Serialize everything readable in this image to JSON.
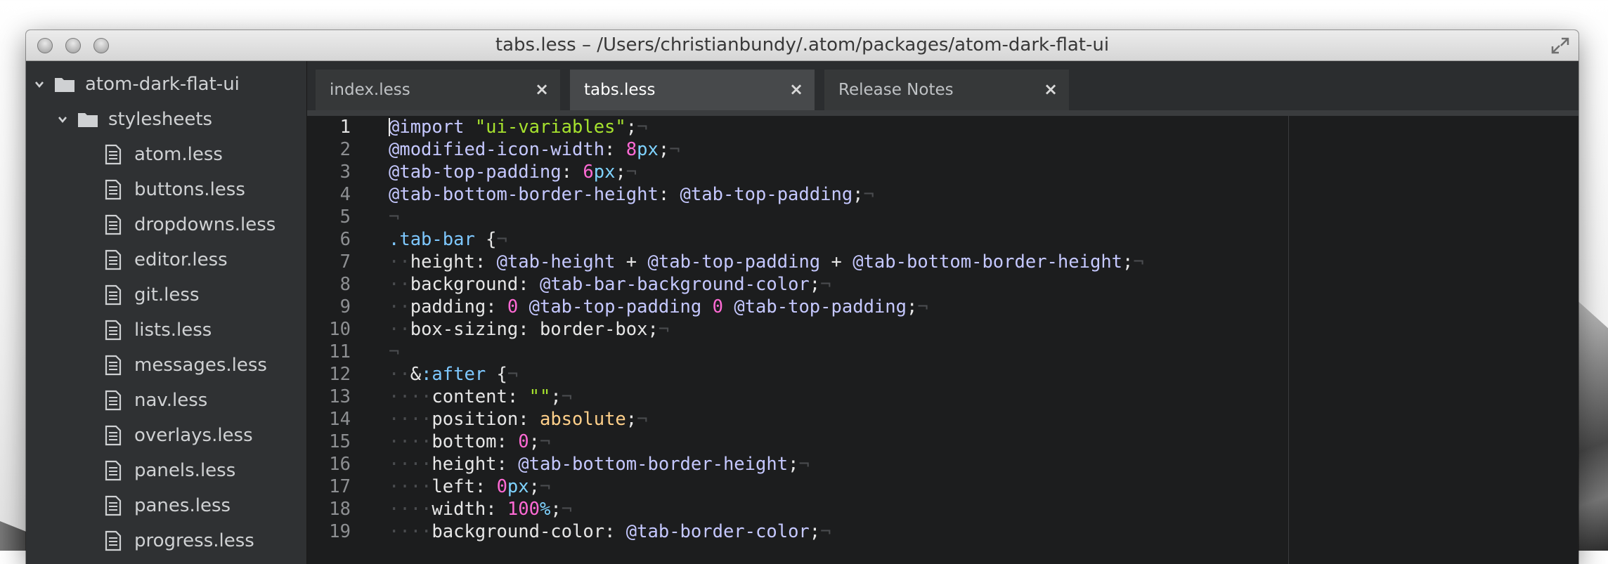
{
  "window": {
    "title": "tabs.less – /Users/christianbundy/.atom/packages/atom-dark-flat-ui"
  },
  "sidebar": {
    "root_folder": "atom-dark-flat-ui",
    "sub_folder": "stylesheets",
    "files": [
      "atom.less",
      "buttons.less",
      "dropdowns.less",
      "editor.less",
      "git.less",
      "lists.less",
      "messages.less",
      "nav.less",
      "overlays.less",
      "panels.less",
      "panes.less",
      "progress.less"
    ]
  },
  "tabs": [
    {
      "label": "index.less",
      "active": false
    },
    {
      "label": "tabs.less",
      "active": true
    },
    {
      "label": "Release Notes",
      "active": false
    }
  ],
  "editor": {
    "current_line": 1,
    "invisible_eol": "¬",
    "invisible_space": "·",
    "lines": [
      [
        [
          "at",
          "@import"
        ],
        [
          "plain",
          " "
        ],
        [
          "str",
          "\"ui-variables\""
        ],
        [
          "plain",
          ";"
        ]
      ],
      [
        [
          "at",
          "@modified-icon-width"
        ],
        [
          "plain",
          ": "
        ],
        [
          "num",
          "8"
        ],
        [
          "unit",
          "px"
        ],
        [
          "plain",
          ";"
        ]
      ],
      [
        [
          "at",
          "@tab-top-padding"
        ],
        [
          "plain",
          ": "
        ],
        [
          "num",
          "6"
        ],
        [
          "unit",
          "px"
        ],
        [
          "plain",
          ";"
        ]
      ],
      [
        [
          "at",
          "@tab-bottom-border-height"
        ],
        [
          "plain",
          ": "
        ],
        [
          "at",
          "@tab-top-padding"
        ],
        [
          "plain",
          ";"
        ]
      ],
      [],
      [
        [
          "sel",
          ".tab-bar"
        ],
        [
          "plain",
          " {"
        ]
      ],
      [
        [
          "inv",
          "··"
        ],
        [
          "prop",
          "height"
        ],
        [
          "plain",
          ": "
        ],
        [
          "at",
          "@tab-height"
        ],
        [
          "plain",
          " + "
        ],
        [
          "at",
          "@tab-top-padding"
        ],
        [
          "plain",
          " + "
        ],
        [
          "at",
          "@tab-bottom-border-height"
        ],
        [
          "plain",
          ";"
        ]
      ],
      [
        [
          "inv",
          "··"
        ],
        [
          "prop",
          "background"
        ],
        [
          "plain",
          ": "
        ],
        [
          "at",
          "@tab-bar-background-color"
        ],
        [
          "plain",
          ";"
        ]
      ],
      [
        [
          "inv",
          "··"
        ],
        [
          "prop",
          "padding"
        ],
        [
          "plain",
          ": "
        ],
        [
          "num",
          "0"
        ],
        [
          "plain",
          " "
        ],
        [
          "at",
          "@tab-top-padding"
        ],
        [
          "plain",
          " "
        ],
        [
          "num",
          "0"
        ],
        [
          "plain",
          " "
        ],
        [
          "at",
          "@tab-top-padding"
        ],
        [
          "plain",
          ";"
        ]
      ],
      [
        [
          "inv",
          "··"
        ],
        [
          "prop",
          "box-sizing"
        ],
        [
          "plain",
          ": border-box;"
        ]
      ],
      [],
      [
        [
          "inv",
          "··"
        ],
        [
          "plain",
          "&"
        ],
        [
          "sel",
          ":after"
        ],
        [
          "plain",
          " {"
        ]
      ],
      [
        [
          "inv",
          "····"
        ],
        [
          "prop",
          "content"
        ],
        [
          "plain",
          ": "
        ],
        [
          "str",
          "\"\""
        ],
        [
          "plain",
          ";"
        ]
      ],
      [
        [
          "inv",
          "····"
        ],
        [
          "prop",
          "position"
        ],
        [
          "plain",
          ": "
        ],
        [
          "kw",
          "absolute"
        ],
        [
          "plain",
          ";"
        ]
      ],
      [
        [
          "inv",
          "····"
        ],
        [
          "prop",
          "bottom"
        ],
        [
          "plain",
          ": "
        ],
        [
          "num",
          "0"
        ],
        [
          "plain",
          ";"
        ]
      ],
      [
        [
          "inv",
          "····"
        ],
        [
          "prop",
          "height"
        ],
        [
          "plain",
          ": "
        ],
        [
          "at",
          "@tab-bottom-border-height"
        ],
        [
          "plain",
          ";"
        ]
      ],
      [
        [
          "inv",
          "····"
        ],
        [
          "prop",
          "left"
        ],
        [
          "plain",
          ": "
        ],
        [
          "num",
          "0"
        ],
        [
          "unit",
          "px"
        ],
        [
          "plain",
          ";"
        ]
      ],
      [
        [
          "inv",
          "····"
        ],
        [
          "prop",
          "width"
        ],
        [
          "plain",
          ": "
        ],
        [
          "num",
          "100"
        ],
        [
          "unit",
          "%"
        ],
        [
          "plain",
          ";"
        ]
      ],
      [
        [
          "inv",
          "····"
        ],
        [
          "prop",
          "background-color"
        ],
        [
          "plain",
          ": "
        ],
        [
          "at",
          "@tab-border-color"
        ],
        [
          "plain",
          ";"
        ]
      ]
    ]
  },
  "colors": {
    "sidebar_bg": "#2f3133",
    "editor_bg": "#1c1d1e",
    "active_tab_bg": "#47494b",
    "variable": "#c5c8ff",
    "string": "#a6e22e",
    "number": "#ff6ad5",
    "unit": "#7fd3ff"
  }
}
